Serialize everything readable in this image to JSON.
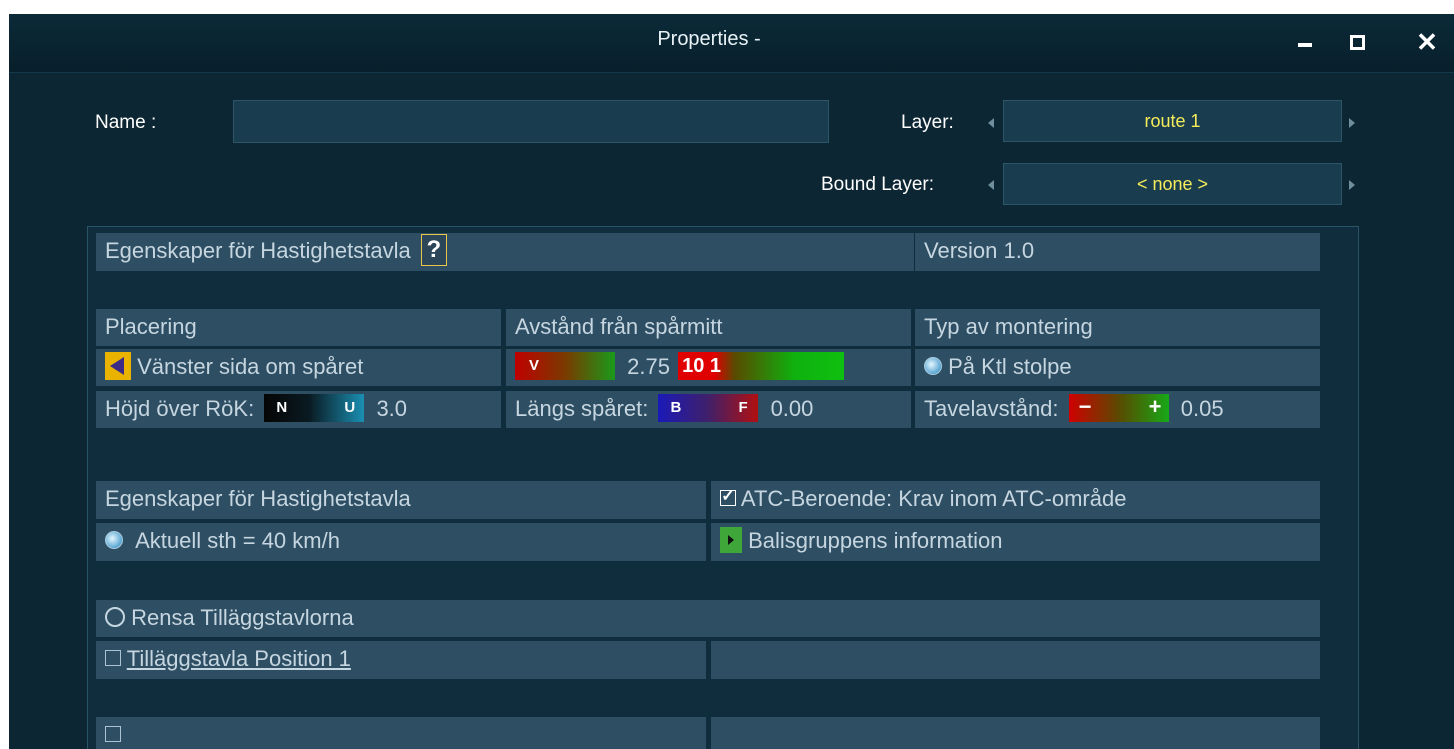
{
  "window": {
    "title": "Properties -"
  },
  "form": {
    "name_label": "Name :",
    "name_value": "",
    "layer_label": "Layer:",
    "layer_value": "route 1",
    "bound_layer_label": "Bound Layer:",
    "bound_layer_value": "< none >"
  },
  "panel": {
    "header_title": "Egenskaper för  Hastighetstavla",
    "help_glyph": "?",
    "version": "Version 1.0",
    "col_headers": [
      "Placering",
      "Avstånd från spårmitt",
      "Typ av montering"
    ],
    "placement_value": "Vänster sida om spåret",
    "distance": {
      "left_tag": "V",
      "value": "2.75",
      "right_tag": "10 1"
    },
    "mounting_value": "På Ktl stolpe",
    "height": {
      "label": "Höjd över RöK:",
      "left_tag": "N",
      "right_tag": "U",
      "value": "3.0"
    },
    "along": {
      "label": "Längs spåret:",
      "left_tag": "B",
      "right_tag": "F",
      "value": "0.00"
    },
    "board_distance": {
      "label": "Tavelavstånd:",
      "left_tag": "−",
      "right_tag": "+",
      "value": "0.05"
    },
    "section2_title": "Egenskaper för Hastighetstavla",
    "atc_label": "ATC-Beroende:  Krav inom ATC-område",
    "current_speed": "Aktuell sth = 40 km/h",
    "balise_label": "Balisgruppens information",
    "clear_label": "Rensa Tilläggstavlorna",
    "addon_position": "Tilläggstavla Position 1"
  },
  "colors": {
    "background": "#0d2633",
    "cell": "#2e4e63",
    "cell_text": "#c6d6e0",
    "select_text": "#f5ec5a"
  },
  "icons": {
    "minimize": "minimize-icon",
    "maximize": "maximize-icon",
    "close": "close-icon",
    "help": "help-icon",
    "placement": "arrow-left-icon",
    "balise": "play-icon"
  }
}
